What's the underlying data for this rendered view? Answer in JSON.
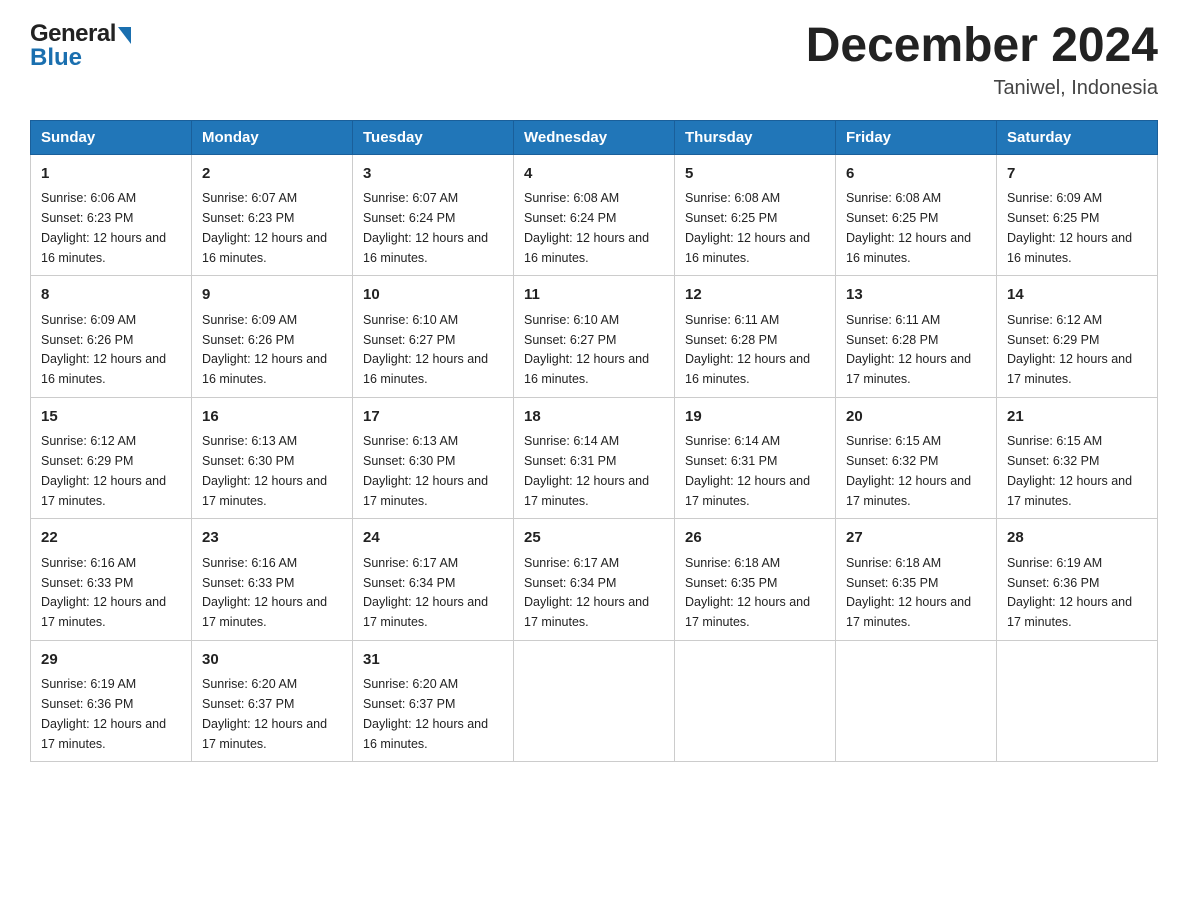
{
  "header": {
    "logo_general": "General",
    "logo_blue": "Blue",
    "month_title": "December 2024",
    "location": "Taniwel, Indonesia"
  },
  "days_of_week": [
    "Sunday",
    "Monday",
    "Tuesday",
    "Wednesday",
    "Thursday",
    "Friday",
    "Saturday"
  ],
  "weeks": [
    [
      {
        "day": "1",
        "sunrise": "6:06 AM",
        "sunset": "6:23 PM",
        "daylight": "12 hours and 16 minutes."
      },
      {
        "day": "2",
        "sunrise": "6:07 AM",
        "sunset": "6:23 PM",
        "daylight": "12 hours and 16 minutes."
      },
      {
        "day": "3",
        "sunrise": "6:07 AM",
        "sunset": "6:24 PM",
        "daylight": "12 hours and 16 minutes."
      },
      {
        "day": "4",
        "sunrise": "6:08 AM",
        "sunset": "6:24 PM",
        "daylight": "12 hours and 16 minutes."
      },
      {
        "day": "5",
        "sunrise": "6:08 AM",
        "sunset": "6:25 PM",
        "daylight": "12 hours and 16 minutes."
      },
      {
        "day": "6",
        "sunrise": "6:08 AM",
        "sunset": "6:25 PM",
        "daylight": "12 hours and 16 minutes."
      },
      {
        "day": "7",
        "sunrise": "6:09 AM",
        "sunset": "6:25 PM",
        "daylight": "12 hours and 16 minutes."
      }
    ],
    [
      {
        "day": "8",
        "sunrise": "6:09 AM",
        "sunset": "6:26 PM",
        "daylight": "12 hours and 16 minutes."
      },
      {
        "day": "9",
        "sunrise": "6:09 AM",
        "sunset": "6:26 PM",
        "daylight": "12 hours and 16 minutes."
      },
      {
        "day": "10",
        "sunrise": "6:10 AM",
        "sunset": "6:27 PM",
        "daylight": "12 hours and 16 minutes."
      },
      {
        "day": "11",
        "sunrise": "6:10 AM",
        "sunset": "6:27 PM",
        "daylight": "12 hours and 16 minutes."
      },
      {
        "day": "12",
        "sunrise": "6:11 AM",
        "sunset": "6:28 PM",
        "daylight": "12 hours and 16 minutes."
      },
      {
        "day": "13",
        "sunrise": "6:11 AM",
        "sunset": "6:28 PM",
        "daylight": "12 hours and 17 minutes."
      },
      {
        "day": "14",
        "sunrise": "6:12 AM",
        "sunset": "6:29 PM",
        "daylight": "12 hours and 17 minutes."
      }
    ],
    [
      {
        "day": "15",
        "sunrise": "6:12 AM",
        "sunset": "6:29 PM",
        "daylight": "12 hours and 17 minutes."
      },
      {
        "day": "16",
        "sunrise": "6:13 AM",
        "sunset": "6:30 PM",
        "daylight": "12 hours and 17 minutes."
      },
      {
        "day": "17",
        "sunrise": "6:13 AM",
        "sunset": "6:30 PM",
        "daylight": "12 hours and 17 minutes."
      },
      {
        "day": "18",
        "sunrise": "6:14 AM",
        "sunset": "6:31 PM",
        "daylight": "12 hours and 17 minutes."
      },
      {
        "day": "19",
        "sunrise": "6:14 AM",
        "sunset": "6:31 PM",
        "daylight": "12 hours and 17 minutes."
      },
      {
        "day": "20",
        "sunrise": "6:15 AM",
        "sunset": "6:32 PM",
        "daylight": "12 hours and 17 minutes."
      },
      {
        "day": "21",
        "sunrise": "6:15 AM",
        "sunset": "6:32 PM",
        "daylight": "12 hours and 17 minutes."
      }
    ],
    [
      {
        "day": "22",
        "sunrise": "6:16 AM",
        "sunset": "6:33 PM",
        "daylight": "12 hours and 17 minutes."
      },
      {
        "day": "23",
        "sunrise": "6:16 AM",
        "sunset": "6:33 PM",
        "daylight": "12 hours and 17 minutes."
      },
      {
        "day": "24",
        "sunrise": "6:17 AM",
        "sunset": "6:34 PM",
        "daylight": "12 hours and 17 minutes."
      },
      {
        "day": "25",
        "sunrise": "6:17 AM",
        "sunset": "6:34 PM",
        "daylight": "12 hours and 17 minutes."
      },
      {
        "day": "26",
        "sunrise": "6:18 AM",
        "sunset": "6:35 PM",
        "daylight": "12 hours and 17 minutes."
      },
      {
        "day": "27",
        "sunrise": "6:18 AM",
        "sunset": "6:35 PM",
        "daylight": "12 hours and 17 minutes."
      },
      {
        "day": "28",
        "sunrise": "6:19 AM",
        "sunset": "6:36 PM",
        "daylight": "12 hours and 17 minutes."
      }
    ],
    [
      {
        "day": "29",
        "sunrise": "6:19 AM",
        "sunset": "6:36 PM",
        "daylight": "12 hours and 17 minutes."
      },
      {
        "day": "30",
        "sunrise": "6:20 AM",
        "sunset": "6:37 PM",
        "daylight": "12 hours and 17 minutes."
      },
      {
        "day": "31",
        "sunrise": "6:20 AM",
        "sunset": "6:37 PM",
        "daylight": "12 hours and 16 minutes."
      },
      null,
      null,
      null,
      null
    ]
  ]
}
